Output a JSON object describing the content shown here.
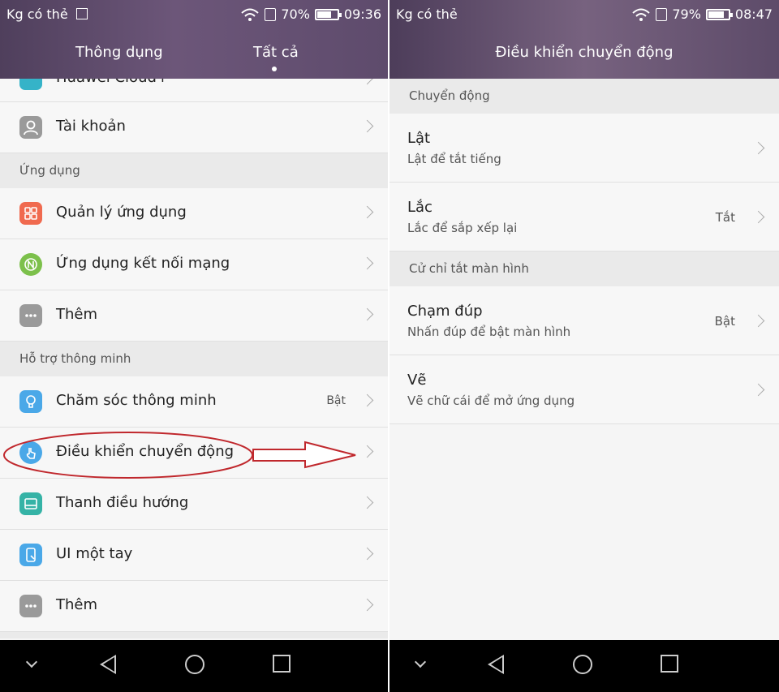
{
  "left": {
    "status": {
      "carrier": "Kg có thẻ",
      "battery": "70%",
      "battery_level": 0.7,
      "time": "09:36"
    },
    "tabs": [
      {
        "label": "Thông dụng"
      },
      {
        "label": "Tất cả"
      }
    ],
    "partial_item": "Huawei Cloud+",
    "rows_top": [
      {
        "label": "Tài khoản",
        "icon": "user-icon",
        "color": "#9a9a9a"
      }
    ],
    "section_apps": "Ứng dụng",
    "rows_apps": [
      {
        "label": "Quản lý ứng dụng",
        "icon": "apps-grid-icon",
        "color": "#f06a4f"
      },
      {
        "label": "Ứng dụng kết nối mạng",
        "icon": "network-icon",
        "color": "#7cc04b"
      },
      {
        "label": "Thêm",
        "icon": "more-icon",
        "color": "#9a9a9a"
      }
    ],
    "section_smart": "Hỗ trợ thông minh",
    "rows_smart": [
      {
        "label": "Chăm sóc thông minh",
        "value": "Bật",
        "icon": "lightbulb-icon",
        "color": "#4aa8e8"
      },
      {
        "label": "Điều khiển chuyển động",
        "icon": "hand-icon",
        "color": "#4aa8e8"
      },
      {
        "label": "Thanh điều hướng",
        "icon": "nav-bar-icon",
        "color": "#35b3a6"
      },
      {
        "label": "UI một tay",
        "icon": "one-hand-icon",
        "color": "#4aa8e8"
      },
      {
        "label": "Thêm",
        "icon": "more-icon",
        "color": "#9a9a9a"
      }
    ]
  },
  "right": {
    "status": {
      "carrier": "Kg có thẻ",
      "battery": "79%",
      "battery_level": 0.79,
      "time": "08:47"
    },
    "title": "Điều khiển chuyển động",
    "section_motion": "Chuyển động",
    "rows_motion": [
      {
        "label": "Lật",
        "sub": "Lật để tắt tiếng",
        "value": ""
      },
      {
        "label": "Lắc",
        "sub": "Lắc để sắp xếp lại",
        "value": "Tắt"
      }
    ],
    "section_gesture": "Cử chỉ tắt màn hình",
    "rows_gesture": [
      {
        "label": "Chạm đúp",
        "sub": "Nhấn đúp để bật màn hình",
        "value": "Bật"
      },
      {
        "label": "Vẽ",
        "sub": "Vẽ chữ cái để mở ứng dụng",
        "value": ""
      }
    ]
  },
  "colors": {
    "annotation_red": "#c0282d"
  }
}
